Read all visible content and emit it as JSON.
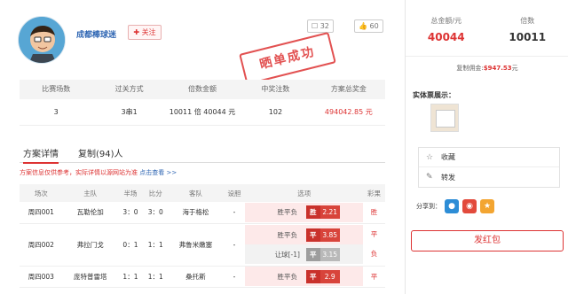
{
  "user": {
    "name": "成都棒球迷",
    "follow": "✚ 关注",
    "comments": "32",
    "likes": "60"
  },
  "stamp": "晒单成功",
  "summary": {
    "headers": [
      "比赛场数",
      "过关方式",
      "倍数金额",
      "中奖注数",
      "方案总奖金"
    ],
    "values": [
      "3",
      "3串1",
      "10011 倍 40044 元",
      "102",
      "494042.85 元"
    ]
  },
  "tabs": [
    "方案详情",
    "复制(94)人"
  ],
  "notice": {
    "text": "方案信息仅供参考，实际详情以源网站为准",
    "link": "点击查看 >>"
  },
  "table": {
    "headers": [
      "场次",
      "主队",
      "半场",
      "比分",
      "客队",
      "设胆",
      "选项",
      "彩果"
    ],
    "rows": [
      {
        "num": "周四001",
        "home": "瓦勒伦加",
        "half": "3：0",
        "score": "3：0",
        "away": "海于格松",
        "banker": "-",
        "options": [
          {
            "label": "胜平负",
            "key": "胜",
            "odds": "2.21",
            "grey": false
          }
        ],
        "result": "胜"
      },
      {
        "num": "周四002",
        "home": "弗拉门戈",
        "half": "0：1",
        "score": "1：1",
        "away": "弗鲁米嫩塞",
        "banker": "-",
        "options": [
          {
            "label": "胜平负",
            "key": "平",
            "odds": "3.85",
            "grey": false
          },
          {
            "label": "让球[-1]",
            "key": "平",
            "odds": "3.15",
            "grey": true
          }
        ],
        "result": "平",
        "result2": "负"
      },
      {
        "num": "周四003",
        "home": "庞特普雷塔",
        "half": "1：1",
        "score": "1：1",
        "away": "桑托斯",
        "banker": "-",
        "options": [
          {
            "label": "胜平负",
            "key": "平",
            "odds": "2.9",
            "grey": false
          }
        ],
        "result": "平"
      }
    ]
  },
  "side": {
    "total_label": "总金额/元",
    "total": "40044",
    "multiple_label": "倍数",
    "multiple": "10011",
    "bonus_label": "复制佣金:",
    "bonus": "$947.53",
    "bonus_unit": "元",
    "ticket_title": "实体票展示：",
    "actions": [
      "收藏",
      "转发"
    ],
    "share": "分享到：",
    "red_button": "发红包"
  }
}
